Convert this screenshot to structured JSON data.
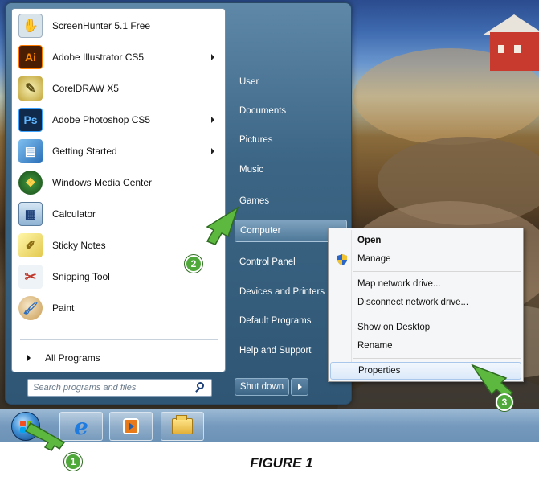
{
  "start_menu": {
    "programs": [
      {
        "label": "ScreenHunter 5.1 Free",
        "icon": "screenhunter-icon",
        "has_submenu": false
      },
      {
        "label": "Adobe Illustrator CS5",
        "icon": "illustrator-icon",
        "has_submenu": true
      },
      {
        "label": "CorelDRAW X5",
        "icon": "coreldraw-icon",
        "has_submenu": false
      },
      {
        "label": "Adobe Photoshop CS5",
        "icon": "photoshop-icon",
        "has_submenu": true
      },
      {
        "label": "Getting Started",
        "icon": "getting-started-icon",
        "has_submenu": true
      },
      {
        "label": "Windows Media Center",
        "icon": "media-center-icon",
        "has_submenu": false
      },
      {
        "label": "Calculator",
        "icon": "calculator-icon",
        "has_submenu": false
      },
      {
        "label": "Sticky Notes",
        "icon": "sticky-notes-icon",
        "has_submenu": false
      },
      {
        "label": "Snipping Tool",
        "icon": "snipping-tool-icon",
        "has_submenu": false
      },
      {
        "label": "Paint",
        "icon": "paint-icon",
        "has_submenu": false
      }
    ],
    "all_programs": "All Programs",
    "search_placeholder": "Search programs and files",
    "right_items": [
      "User",
      "Documents",
      "Pictures",
      "Music",
      "Games",
      "Computer",
      "Control Panel",
      "Devices and Printers",
      "Default Programs",
      "Help and Support"
    ],
    "shutdown_label": "Shut down"
  },
  "context_menu": {
    "open": "Open",
    "manage": "Manage",
    "map_drive": "Map network drive...",
    "disconnect_drive": "Disconnect network drive...",
    "show_desktop": "Show on Desktop",
    "rename": "Rename",
    "properties": "Properties"
  },
  "taskbar": {
    "items": [
      "windows-orb-icon",
      "internet-explorer-icon",
      "media-player-icon",
      "file-explorer-icon"
    ]
  },
  "callouts": [
    "1",
    "2",
    "3"
  ],
  "caption": "FIGURE 1",
  "colors": {
    "callout_green": "#4fa83a",
    "start_menu_blue": "#3c6585",
    "highlight": "#dbe9f9"
  }
}
